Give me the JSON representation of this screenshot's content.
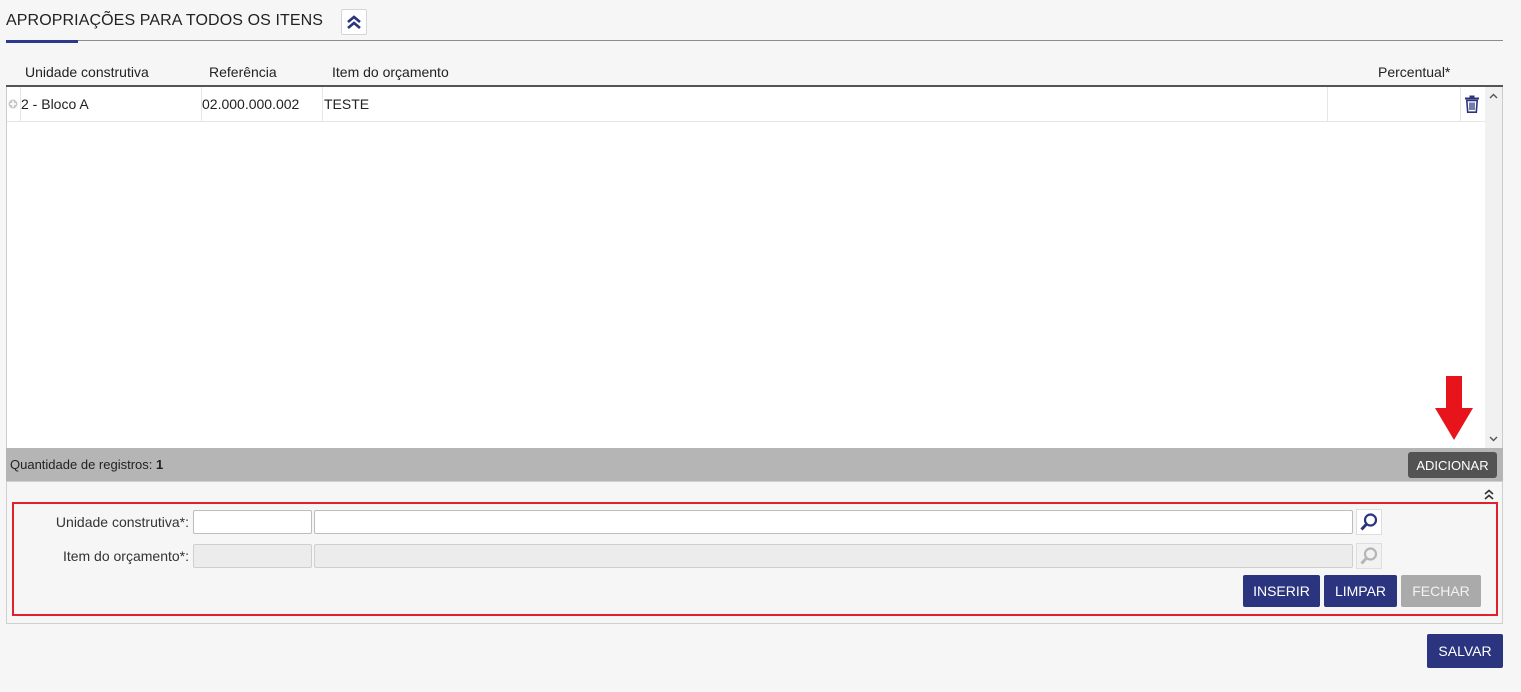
{
  "section": {
    "title": "APROPRIAÇÕES PARA TODOS OS ITENS"
  },
  "grid": {
    "columns": {
      "unidade": "Unidade construtiva",
      "referencia": "Referência",
      "item": "Item do orçamento",
      "percentual": "Percentual*"
    },
    "rows": [
      {
        "unidade": "2 - Bloco A",
        "referencia": "02.000.000.002",
        "item": "TESTE",
        "percentual": ""
      }
    ],
    "count_label": "Quantidade de registros:",
    "count_value": "1",
    "add_button": "ADICIONAR"
  },
  "form": {
    "unidade_label": "Unidade construtiva*:",
    "unidade_code": "",
    "unidade_desc": "",
    "item_label": "Item do orçamento*:",
    "item_code": "",
    "item_desc": "",
    "inserir": "INSERIR",
    "limpar": "LIMPAR",
    "fechar": "FECHAR"
  },
  "save_button": "SALVAR",
  "colors": {
    "primary": "#2b357f",
    "highlight": "#e0202a",
    "footer_bar": "#b5b5b5"
  },
  "icons": [
    "chevron-double-up-icon",
    "expand-plus-icon",
    "trash-icon",
    "search-icon",
    "arrow-down-icon"
  ]
}
